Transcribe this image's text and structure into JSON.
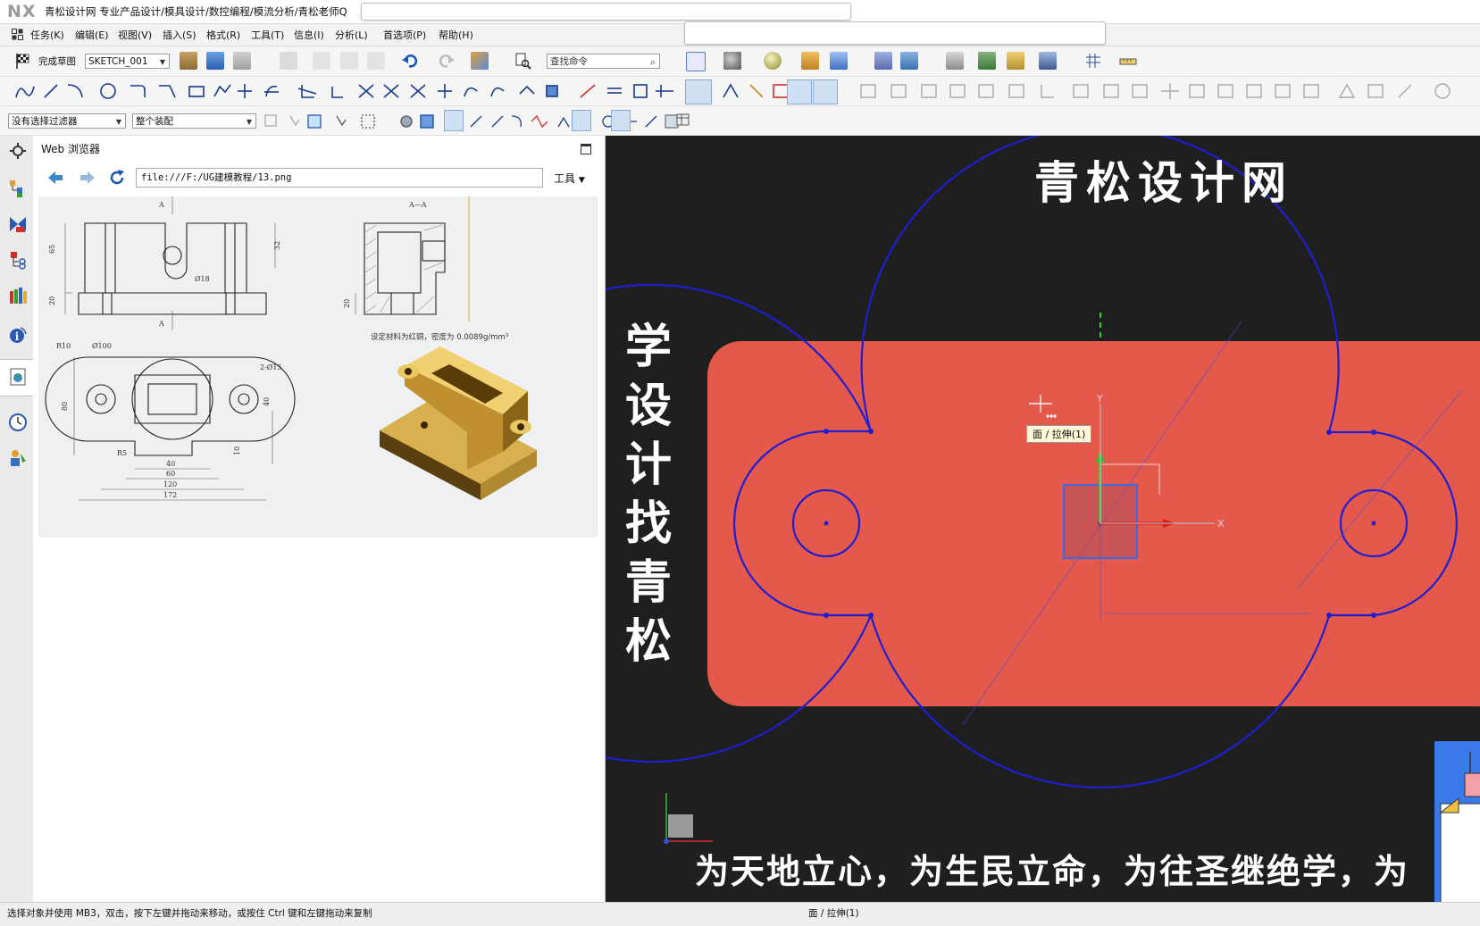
{
  "titlebar": {
    "logo": "NX",
    "title": "青松设计网 专业产品设计/模具设计/数控编程/模流分析/青松老师Q"
  },
  "menubar": {
    "items": [
      "任务(K)",
      "编辑(E)",
      "视图(V)",
      "插入(S)",
      "格式(R)",
      "工具(T)",
      "信息(I)",
      "分析(L)",
      "首选项(P)",
      "帮助(H)"
    ]
  },
  "toolbar1": {
    "finish_sketch": "完成草图",
    "sketch_name": "SKETCH_001",
    "search_placeholder": "查找命令"
  },
  "toolbar3": {
    "selection_filter": "没有选择过滤器",
    "assembly_scope": "整个装配"
  },
  "panel": {
    "title": "Web 浏览器",
    "url": "file:///F:/UG建模教程/13.png",
    "tools_label": "工具"
  },
  "drawing": {
    "section_label": "A—A",
    "cut_label": "A",
    "material_note": "设定材料为红铜，密度为 0.0089g/mm³",
    "dims": {
      "h65": "65",
      "h20": "20",
      "h32": "32",
      "d18": "Ø18",
      "h20b": "20",
      "r10": "R10",
      "d100": "Ø100",
      "two_d15": "2-Ø15",
      "h80": "80",
      "h40": "40",
      "h10": "10",
      "r5": "R5",
      "w40": "40",
      "w60": "60",
      "w120": "120",
      "w172": "172"
    }
  },
  "viewport": {
    "title": "青松设计网",
    "vertical_text": [
      "学",
      "设",
      "计",
      "找",
      "青",
      "松"
    ],
    "slogan": "为天地立心，为生民立命，为往圣继绝学，为",
    "tooltip": "面 / 拉伸(1)",
    "axis_x": "X",
    "axis_y": "Y",
    "colors": {
      "background": "#1f1f1f",
      "face": "#e4594b",
      "sketch_curve": "#1f1fd0"
    }
  },
  "statusbar": {
    "left": "选择对象并使用 MB3，双击，按下左键并拖动来移动，或按住 Ctrl 键和左键拖动来复制",
    "right": "面 / 拉伸(1)"
  }
}
